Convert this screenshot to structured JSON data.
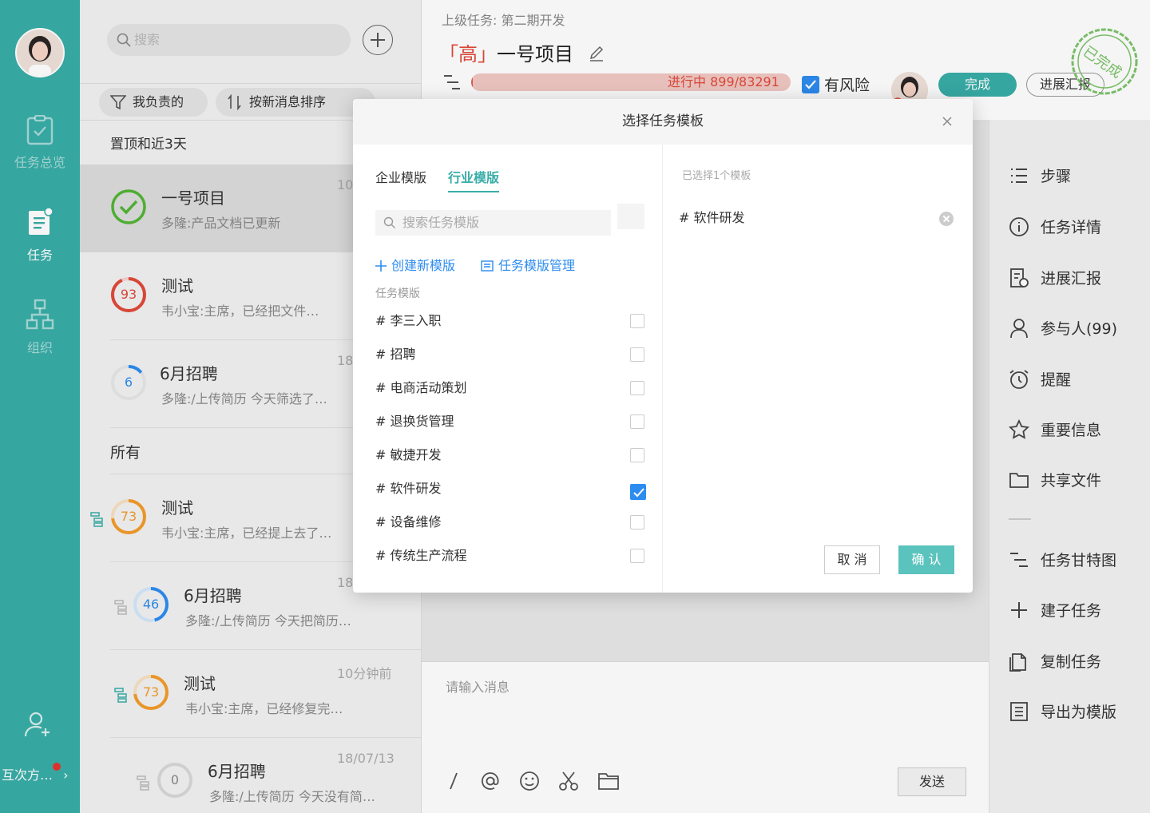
{
  "nav": {
    "items": [
      {
        "label": "任务总览",
        "icon": "clipboard-icon"
      },
      {
        "label": "任务",
        "icon": "task-doc-icon"
      },
      {
        "label": "组织",
        "icon": "org-chart-icon"
      }
    ],
    "bottom_label": "互次方…"
  },
  "list": {
    "search_placeholder": "搜索",
    "filter_mine": "我负责的",
    "filter_sort": "按新消息排序",
    "section_pinned": "置顶和近3天",
    "section_all": "所有",
    "tasks": [
      {
        "title": "一号项目",
        "sub": "多隆:产品文档已更新",
        "time": "10",
        "badge": ""
      },
      {
        "title": "测试",
        "sub": "韦小宝:主席，已经把文件…",
        "time": "",
        "badge": "93"
      },
      {
        "title": "6月招聘",
        "sub": "多隆:/上传简历 今天筛选了…",
        "time": "18",
        "badge": "6"
      },
      {
        "title": "测试",
        "sub": "韦小宝:主席，已经提上去了…",
        "time": "",
        "badge": "73"
      },
      {
        "title": "6月招聘",
        "sub": "多隆:/上传简历 今天把简历…",
        "time": "18",
        "badge": "46"
      },
      {
        "title": "测试",
        "sub": "韦小宝:主席，已经修复完…",
        "time": "10分钟前",
        "badge": "73"
      },
      {
        "title": "6月招聘",
        "sub": "多隆:/上传简历 今天没有简…",
        "time": "18/07/13",
        "badge": "0"
      }
    ]
  },
  "header": {
    "parent_label": "上级任务:   第二期开发",
    "priority": "「高」",
    "title": "一号项目",
    "progress_text": "进行中  899/83291",
    "risk_label": "有风险",
    "done_label": "完成",
    "report_label": "进展汇报",
    "stamp_text": "已完成"
  },
  "right_panel": {
    "items": [
      {
        "label": "步骤",
        "icon": "list-icon"
      },
      {
        "label": "任务详情",
        "icon": "info-icon"
      },
      {
        "label": "进展汇报",
        "icon": "report-icon"
      },
      {
        "label": "参与人(99)",
        "icon": "person-icon"
      },
      {
        "label": "提醒",
        "icon": "alarm-icon"
      },
      {
        "label": "重要信息",
        "icon": "star-icon"
      },
      {
        "label": "共享文件",
        "icon": "folder-icon"
      },
      {
        "label": "任务甘特图",
        "icon": "gantt-icon"
      },
      {
        "label": "建子任务",
        "icon": "plus-icon"
      },
      {
        "label": "复制任务",
        "icon": "copy-icon"
      },
      {
        "label": "导出为模版",
        "icon": "export-icon"
      }
    ]
  },
  "input": {
    "placeholder": "请输入消息",
    "send_label": "发送",
    "tools": [
      "slash-icon",
      "at-icon",
      "emoji-icon",
      "scissors-icon",
      "folder-icon"
    ]
  },
  "modal": {
    "title": "选择任务模板",
    "tab_enterprise": "企业模版",
    "tab_industry": "行业模版",
    "search_placeholder": "搜索任务模版",
    "create_link": "创建新模版",
    "manage_link": "任务模版管理",
    "list_label": "任务模版",
    "templates": [
      {
        "name": "# 李三入职",
        "checked": false
      },
      {
        "name": "# 招聘",
        "checked": false
      },
      {
        "name": "# 电商活动策划",
        "checked": false
      },
      {
        "name": "# 退换货管理",
        "checked": false
      },
      {
        "name": "# 敏捷开发",
        "checked": false
      },
      {
        "name": "# 软件研发",
        "checked": true
      },
      {
        "name": "# 设备维修",
        "checked": false
      },
      {
        "name": "# 传统生产流程",
        "checked": false
      }
    ],
    "selected_label": "已选择1个模板",
    "selected_item": "# 软件研发",
    "cancel_label": "取 消",
    "ok_label": "确 认"
  },
  "colors": {
    "brand": "#39ada7",
    "link": "#2d8cf0",
    "danger": "#e04a3a",
    "ring_red": "#e04a3a",
    "ring_blue": "#2d8cf0",
    "ring_orange": "#f39c2b",
    "ring_green": "#52b535"
  }
}
